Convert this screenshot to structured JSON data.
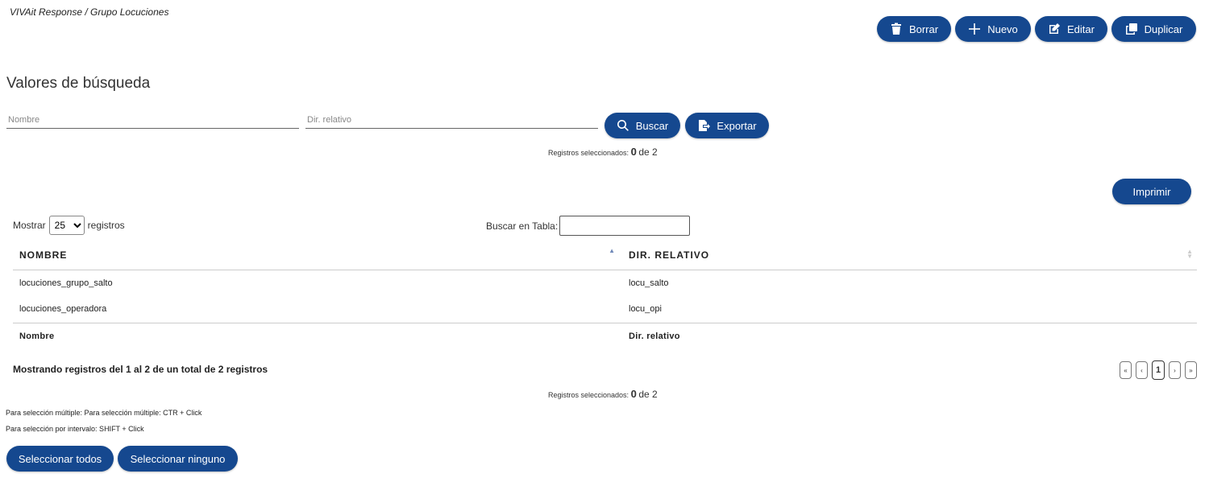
{
  "breadcrumb": "VIVAit Response / Grupo Locuciones",
  "toolbar": {
    "borrar": "Borrar",
    "nuevo": "Nuevo",
    "editar": "Editar",
    "duplicar": "Duplicar"
  },
  "search": {
    "title": "Valores de búsqueda",
    "nombre_placeholder": "Nombre",
    "dir_placeholder": "Dir. relativo",
    "buscar": "Buscar",
    "exportar": "Exportar"
  },
  "selection_top": {
    "label": "Registros seleccionados:",
    "count": "0",
    "of": "de 2"
  },
  "imprimir": "Imprimir",
  "table_controls": {
    "show_label": "Mostrar",
    "show_value": "25",
    "show_suffix": "registros",
    "filter_label": "Buscar en Tabla:"
  },
  "table": {
    "headers": [
      "NOMBRE",
      "DIR. RELATIVO"
    ],
    "rows": [
      [
        "locuciones_grupo_salto",
        "locu_salto"
      ],
      [
        "locuciones_operadora",
        "locu_opi"
      ]
    ],
    "footers": [
      "Nombre",
      "Dir. relativo"
    ]
  },
  "info": "Mostrando registros del 1 al 2 de un total de 2 registros",
  "pager": {
    "first": "«",
    "prev": "‹",
    "current": "1",
    "next": "›",
    "last": "»"
  },
  "selection_bottom": {
    "label": "Registros seleccionados:",
    "count": "0",
    "of": "de 2"
  },
  "hints": {
    "multiple": "Para selección múltiple: Para selección múltiple: CTR + Click",
    "interval": "Para selección por intervalo: SHIFT + Click"
  },
  "bottom_buttons": {
    "all": "Seleccionar todos",
    "none": "Seleccionar ninguno"
  },
  "colors": {
    "primary": "#15488f"
  }
}
